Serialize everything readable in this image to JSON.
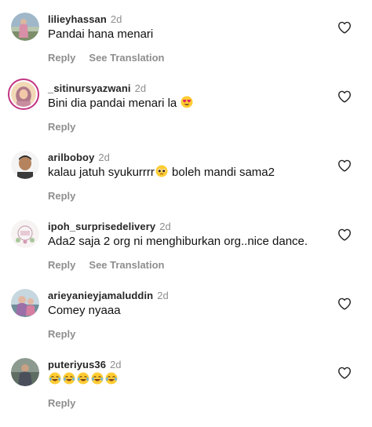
{
  "comments": [
    {
      "username": "lilieyhassan",
      "time": "2d",
      "text": "Pandai hana menari",
      "reply": "Reply",
      "translate": "See Translation",
      "avatar": "profile-photo-icon"
    },
    {
      "username": "_sitinursyazwani",
      "time": "2d",
      "text": "Bini dia pandai menari la",
      "emoji": "heart-eyes-emoji",
      "reply": "Reply",
      "avatar": "profile-photo-icon"
    },
    {
      "username": "arilboboy",
      "time": "2d",
      "text_before": "kalau jatuh syukurrrr",
      "emoji": "pleading-face-emoji",
      "text_after": " boleh mandi sama2",
      "reply": "Reply",
      "avatar": "profile-photo-icon"
    },
    {
      "username": "ipoh_surprisedelivery",
      "time": "2d",
      "text": "Ada2 saja 2 org ni menghiburkan org..nice dance.",
      "reply": "Reply",
      "translate": "See Translation",
      "avatar": "profile-photo-icon"
    },
    {
      "username": "arieyanieyjamaluddin",
      "time": "2d",
      "text": "Comey nyaaa",
      "reply": "Reply",
      "avatar": "profile-photo-icon"
    },
    {
      "username": "puteriyus36",
      "time": "2d",
      "emojis": [
        "joy-emoji",
        "joy-emoji",
        "joy-emoji",
        "joy-emoji",
        "joy-emoji"
      ],
      "reply": "Reply",
      "avatar": "profile-photo-icon"
    }
  ],
  "colors": {
    "username": "#262626",
    "secondary": "#8e8e8e",
    "text": "#111111",
    "story_ring": "#c13584"
  },
  "icons": {
    "like": "heart-outline-icon"
  }
}
